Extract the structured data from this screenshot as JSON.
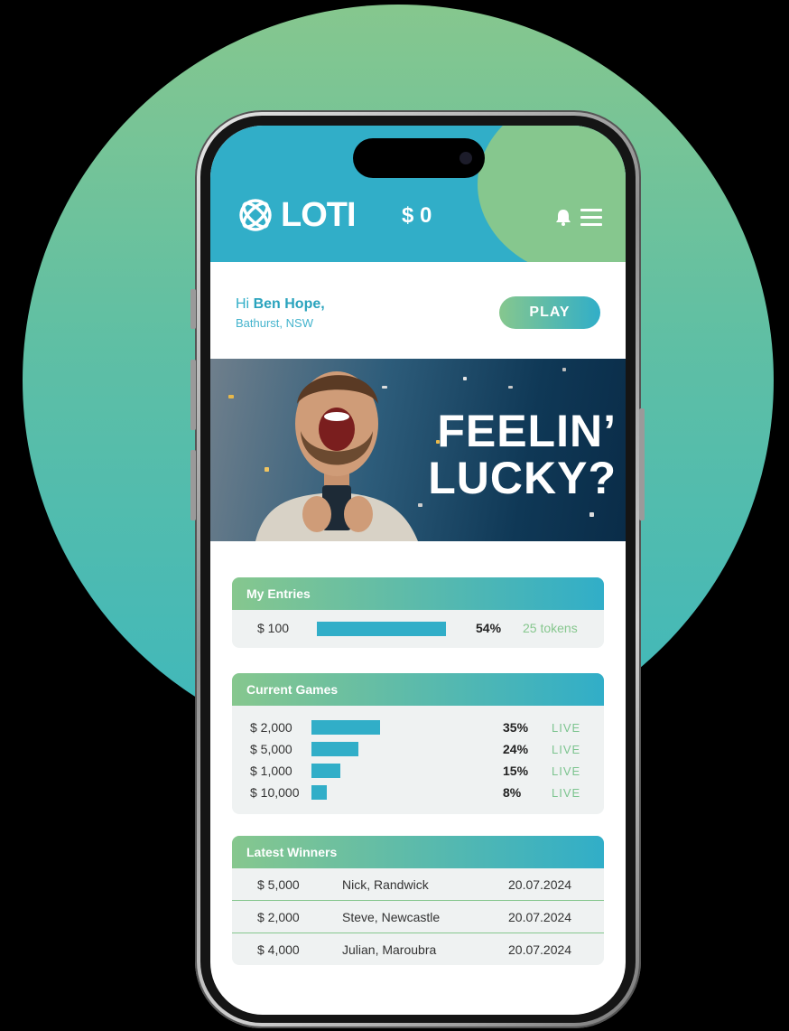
{
  "app": {
    "name": "LOTI",
    "balance": "$ 0"
  },
  "greeting": {
    "hi": "Hi",
    "name": "Ben Hope,",
    "location": "Bathurst, NSW",
    "play_label": "PLAY"
  },
  "hero": {
    "line1": "FEELIN’",
    "line2": "LUCKY?"
  },
  "my_entries": {
    "title": "My Entries",
    "amount": "$ 100",
    "progress": 0.54,
    "percent": "54%",
    "tokens": "25 tokens"
  },
  "current_games": {
    "title": "Current Games",
    "rows": [
      {
        "amount": "$ 2,000",
        "progress": 0.35,
        "percent": "35%",
        "status": "LIVE"
      },
      {
        "amount": "$ 5,000",
        "progress": 0.24,
        "percent": "24%",
        "status": "LIVE"
      },
      {
        "amount": "$ 1,000",
        "progress": 0.15,
        "percent": "15%",
        "status": "LIVE"
      },
      {
        "amount": "$ 10,000",
        "progress": 0.08,
        "percent": "8%",
        "status": "LIVE"
      }
    ]
  },
  "latest_winners": {
    "title": "Latest Winners",
    "rows": [
      {
        "amount": "$ 5,000",
        "name": "Nick, Randwick",
        "date": "20.07.2024"
      },
      {
        "amount": "$ 2,000",
        "name": "Steve, Newcastle",
        "date": "20.07.2024"
      },
      {
        "amount": "$ 4,000",
        "name": "Julian, Maroubra",
        "date": "20.07.2024"
      }
    ]
  },
  "colors": {
    "teal": "#31aec8",
    "green": "#86c78e",
    "background": "#000000"
  }
}
